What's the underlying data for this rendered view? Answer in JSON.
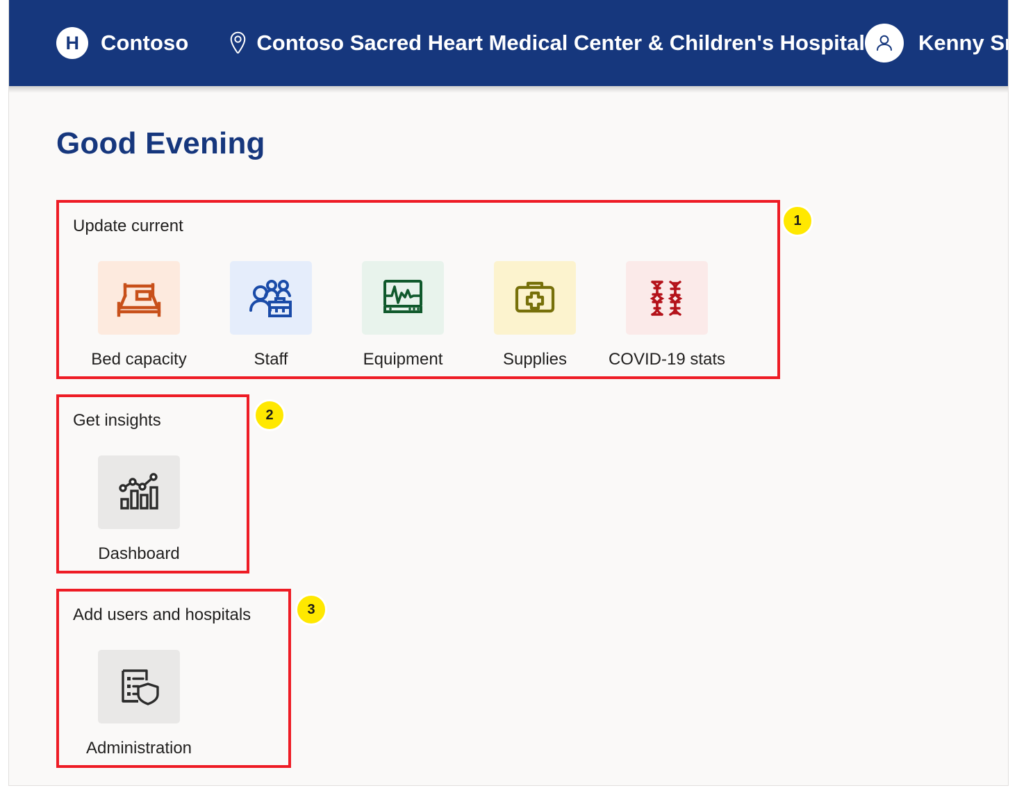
{
  "header": {
    "logo_letter": "H",
    "brand_name": "Contoso",
    "location_icon": "location-pin-icon",
    "facility_name": "Contoso Sacred Heart Medical Center & Children's Hospital",
    "user_name": "Kenny Smith",
    "avatar_icon": "person-icon",
    "background_color": "#16377d"
  },
  "main": {
    "greeting": "Good Evening",
    "greeting_color": "#16377d"
  },
  "sections": [
    {
      "title": "Update current",
      "badge": "1",
      "tiles": [
        {
          "label": "Bed capacity",
          "icon": "bed-icon",
          "tile_bg": "#fdeade",
          "icon_color": "#c8501a"
        },
        {
          "label": "Staff",
          "icon": "people-icon",
          "tile_bg": "#e5edfb",
          "icon_color": "#1a4ba8"
        },
        {
          "label": "Equipment",
          "icon": "monitor-icon",
          "tile_bg": "#e8f3ec",
          "icon_color": "#10592c"
        },
        {
          "label": "Supplies",
          "icon": "first-aid-icon",
          "tile_bg": "#fcf3ce",
          "icon_color": "#77700a"
        },
        {
          "label": "COVID-19 stats",
          "icon": "dna-icon",
          "tile_bg": "#fbeae9",
          "icon_color": "#b4121a"
        }
      ]
    },
    {
      "title": "Get insights",
      "badge": "2",
      "tiles": [
        {
          "label": "Dashboard",
          "icon": "chart-icon",
          "tile_bg": "#e9e8e7",
          "icon_color": "#2b2b2b"
        }
      ]
    },
    {
      "title": "Add users and hospitals",
      "badge": "3",
      "tiles": [
        {
          "label": "Administration",
          "icon": "list-shield-icon",
          "tile_bg": "#e9e8e7",
          "icon_color": "#2b2b2b"
        }
      ]
    }
  ],
  "annotation": {
    "box_color": "#ee1c25",
    "badge_color": "#ffe800"
  }
}
